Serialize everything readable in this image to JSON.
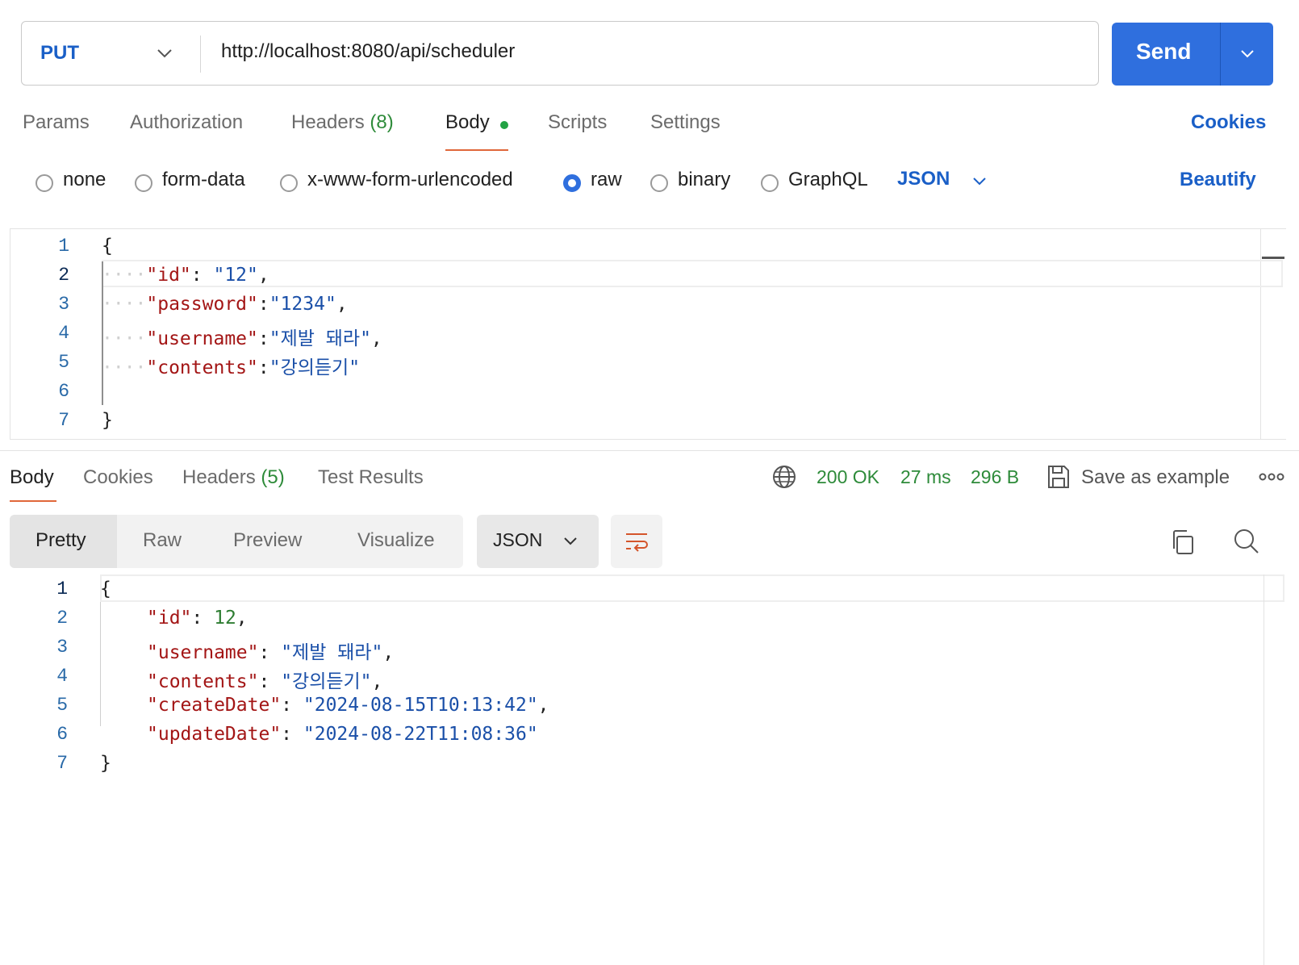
{
  "request": {
    "method": "PUT",
    "url": "http://localhost:8080/api/scheduler",
    "send_label": "Send"
  },
  "request_tabs": [
    {
      "label": "Params"
    },
    {
      "label": "Authorization"
    },
    {
      "label": "Headers",
      "count": "(8)"
    },
    {
      "label": "Body",
      "active": true
    },
    {
      "label": "Scripts"
    },
    {
      "label": "Settings"
    }
  ],
  "cookies_label": "Cookies",
  "body_types": [
    {
      "label": "none"
    },
    {
      "label": "form-data"
    },
    {
      "label": "x-www-form-urlencoded"
    },
    {
      "label": "raw",
      "selected": true
    },
    {
      "label": "binary"
    },
    {
      "label": "GraphQL"
    }
  ],
  "body_format": "JSON",
  "beautify_label": "Beautify",
  "request_body": {
    "line_numbers": [
      "1",
      "2",
      "3",
      "4",
      "5",
      "6",
      "7"
    ],
    "open_brace": "{",
    "close_brace": "}",
    "fields": [
      {
        "key": "\"id\"",
        "sep": ": ",
        "value": "\"12\"",
        "trail": ","
      },
      {
        "key": "\"password\"",
        "sep": ":",
        "value": "\"1234\"",
        "trail": ","
      },
      {
        "key": "\"username\"",
        "sep": ":",
        "value": "\"제발 돼라\"",
        "trail": ","
      },
      {
        "key": "\"contents\"",
        "sep": ":",
        "value": "\"강의듣기\"",
        "trail": ""
      }
    ]
  },
  "response_tabs": [
    {
      "label": "Body",
      "active": true
    },
    {
      "label": "Cookies"
    },
    {
      "label": "Headers",
      "count": "(5)"
    },
    {
      "label": "Test Results"
    }
  ],
  "response_status": {
    "status": "200 OK",
    "time": "27 ms",
    "size": "296 B",
    "save_label": "Save as example"
  },
  "view_modes": [
    {
      "label": "Pretty",
      "active": true
    },
    {
      "label": "Raw"
    },
    {
      "label": "Preview"
    },
    {
      "label": "Visualize"
    }
  ],
  "response_format": "JSON",
  "response_body": {
    "line_numbers": [
      "1",
      "2",
      "3",
      "4",
      "5",
      "6",
      "7"
    ],
    "open_brace": "{",
    "close_brace": "}",
    "fields": [
      {
        "key": "\"id\"",
        "value": "12",
        "trail": ","
      },
      {
        "key": "\"username\"",
        "value": "\"제발 돼라\"",
        "trail": ","
      },
      {
        "key": "\"contents\"",
        "value": "\"강의듣기\"",
        "trail": ","
      },
      {
        "key": "\"createDate\"",
        "value": "\"2024-08-15T10:13:42\"",
        "trail": ","
      },
      {
        "key": "\"updateDate\"",
        "value": "\"2024-08-22T11:08:36\"",
        "trail": ""
      }
    ]
  },
  "colors": {
    "accent": "#2f6fde",
    "link": "#1a5fc7",
    "status_green": "#2e8b3a",
    "active_tab_underline": "#e0673a",
    "json_key": "#a31515",
    "json_string": "#1a4fa8",
    "json_number": "#2e7d32"
  },
  "icons": [
    "chevron-down-icon",
    "globe-icon",
    "save-icon",
    "more-horizontal-icon",
    "wrap-lines-icon",
    "copy-icon",
    "search-icon"
  ]
}
